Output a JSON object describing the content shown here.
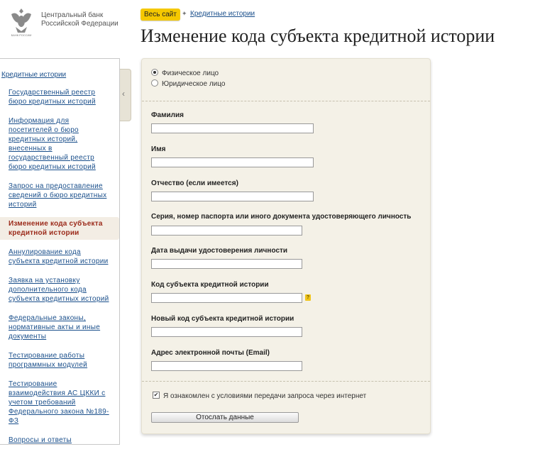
{
  "header": {
    "bank_name_line1": "Центральный банк",
    "bank_name_line2": "Российской Федерации",
    "emblem_caption": "БАНК РОССИИ",
    "breadcrumb_all": "Весь сайт",
    "breadcrumb_sep": "✦",
    "breadcrumb_link": "Кредитные истории",
    "title": "Изменение кода субъекта кредитной истории"
  },
  "sidebar": {
    "heading": "Кредитные истории",
    "toggle_glyph": "‹",
    "items": [
      {
        "label": "Государственный реестр бюро кредитных историй",
        "active": false
      },
      {
        "label": "Информация для посетителей о бюро кредитных историй, внесенных в государственный реестр бюро кредитных историй",
        "active": false
      },
      {
        "label": "Запрос на предоставление сведений о бюро кредитных историй",
        "active": false
      },
      {
        "label": "Изменение кода субъекта кредитной истории",
        "active": true
      },
      {
        "label": "Аннулирование кода субъекта кредитной истории",
        "active": false
      },
      {
        "label": "Заявка на установку дополнительного кода субъекта кредитных историй",
        "active": false
      },
      {
        "label": "Федеральные законы, нормативные акты и иные документы",
        "active": false
      },
      {
        "label": "Тестирование работы программных модулей",
        "active": false
      },
      {
        "label": "Тестирование взаимодействия АС ЦККИ с учетом требований Федерального закона №189-ФЗ",
        "active": false
      },
      {
        "label": "Вопросы и ответы",
        "active": false
      }
    ]
  },
  "form": {
    "person_type": {
      "options": [
        "Физическое лицо",
        "Юридическое лицо"
      ],
      "selected": "Физическое лицо"
    },
    "fields": {
      "surname": {
        "label": "Фамилия",
        "value": ""
      },
      "name": {
        "label": "Имя",
        "value": ""
      },
      "patronymic": {
        "label": "Отчество (если имеется)",
        "value": ""
      },
      "passport": {
        "label": "Серия, номер паспорта или иного документа удостоверяющего личность",
        "value": ""
      },
      "issue_date": {
        "label": "Дата выдачи удостоверения личности",
        "value": ""
      },
      "subject_code": {
        "label": "Код субъекта кредитной истории",
        "value": ""
      },
      "new_code": {
        "label": "Новый код субъекта кредитной истории",
        "value": ""
      },
      "email": {
        "label": "Адрес электронной почты (Email)",
        "value": ""
      }
    },
    "help_glyph": "?",
    "consent": {
      "label": "Я ознакомлен с условиями передачи запроса через интернет",
      "checked": true
    },
    "submit_label": "Отослать данные"
  },
  "colors": {
    "link": "#1a4f8b",
    "active_item": "#9b2a1a",
    "breadcrumb_badge": "#f5c800",
    "panel_bg": "#f4f1e7"
  }
}
